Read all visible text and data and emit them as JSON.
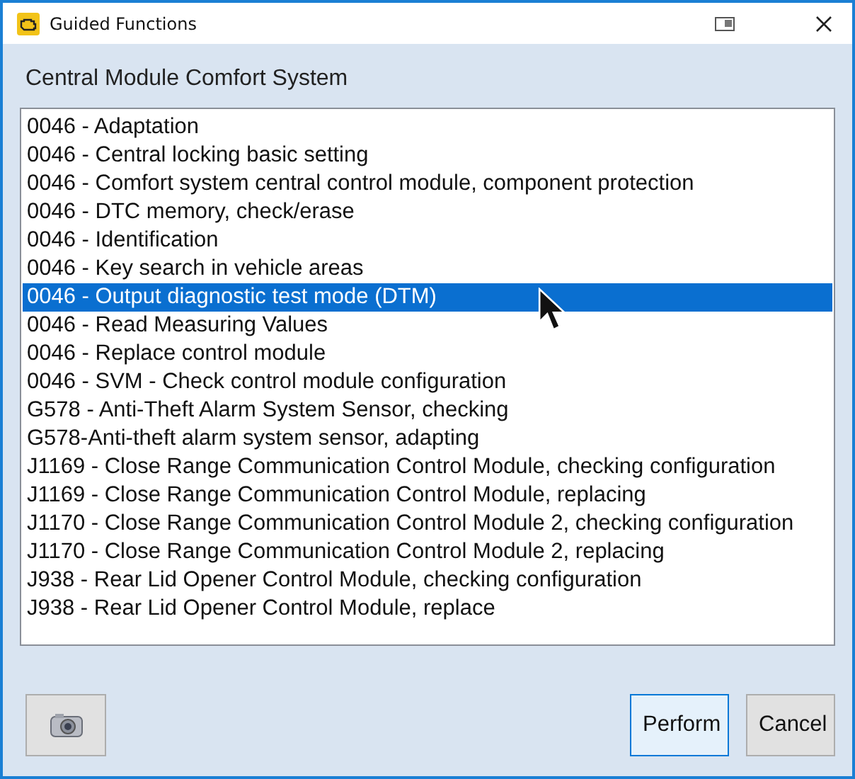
{
  "window": {
    "title": "Guided Functions"
  },
  "heading": "Central Module Comfort System",
  "functions": [
    {
      "label": "0046 - Adaptation",
      "selected": false
    },
    {
      "label": "0046 - Central locking basic setting",
      "selected": false
    },
    {
      "label": "0046 - Comfort system central control module, component protection",
      "selected": false
    },
    {
      "label": "0046 - DTC memory, check/erase",
      "selected": false
    },
    {
      "label": "0046 - Identification",
      "selected": false
    },
    {
      "label": "0046 - Key search in vehicle areas",
      "selected": false
    },
    {
      "label": "0046 - Output diagnostic test mode (DTM)",
      "selected": true
    },
    {
      "label": "0046 - Read Measuring Values",
      "selected": false
    },
    {
      "label": "0046 - Replace control module",
      "selected": false
    },
    {
      "label": "0046 - SVM - Check control module configuration",
      "selected": false
    },
    {
      "label": "G578 - Anti-Theft Alarm System Sensor, checking",
      "selected": false
    },
    {
      "label": "G578-Anti-theft alarm system sensor, adapting",
      "selected": false
    },
    {
      "label": "J1169 - Close Range Communication Control Module, checking configuration",
      "selected": false
    },
    {
      "label": "J1169 - Close Range Communication Control Module, replacing",
      "selected": false
    },
    {
      "label": "J1170 - Close Range Communication Control Module 2, checking configuration",
      "selected": false
    },
    {
      "label": "J1170 - Close Range Communication Control Module 2, replacing",
      "selected": false
    },
    {
      "label": "J938 - Rear Lid Opener Control Module, checking configuration",
      "selected": false
    },
    {
      "label": "J938 - Rear Lid Opener Control Module, replace",
      "selected": false
    }
  ],
  "buttons": [
    {
      "label": "Perform",
      "kind": "default"
    },
    {
      "label": "Cancel",
      "kind": "normal"
    }
  ]
}
